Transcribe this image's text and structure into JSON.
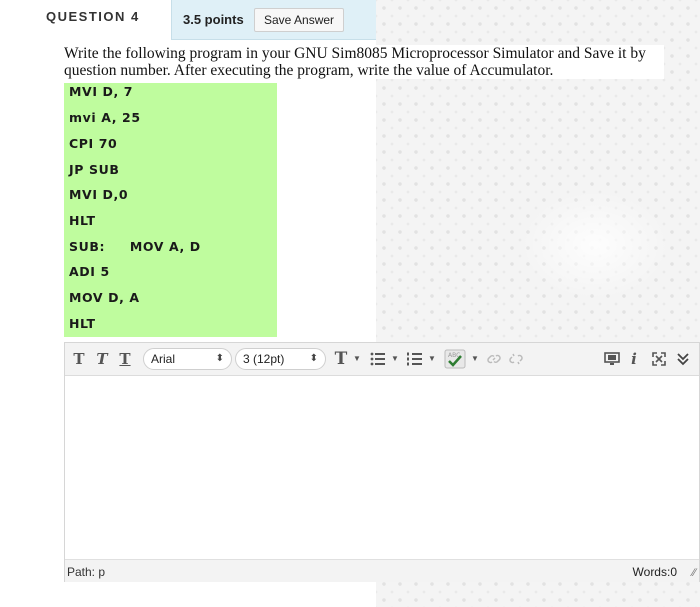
{
  "question": {
    "title": "QUESTION 4",
    "points": "3.5 points",
    "save_label": "Save Answer",
    "text": "Write the following program in your GNU Sim8085 Microprocessor Simulator and Save it by question number. After executing the program, write the value of Accumulator."
  },
  "code_lines": [
    "MVI D, 7",
    "mvi A, 25",
    "CPI 70",
    "JP SUB",
    "MVI D,0",
    "HLT",
    "SUB:     MOV A, D",
    "ADI 5",
    "MOV D, A",
    "HLT"
  ],
  "editor": {
    "toolbar": {
      "bold_glyph": "T",
      "italic_glyph": "T",
      "underline_glyph": "T",
      "font_family": "Arial",
      "font_size": "3 (12pt)",
      "text_color_glyph": "T",
      "bullet_list_icon": "bullet-list-icon",
      "numbered_list_icon": "numbered-list-icon",
      "spellcheck_icon": "spellcheck-icon",
      "link_icon": "link-icon",
      "unlink_icon": "unlink-icon",
      "preview_icon": "preview-icon",
      "info_icon": "info-icon",
      "fullscreen_icon": "fullscreen-icon",
      "collapse_icon": "collapse-icon"
    },
    "path_label": "Path: p",
    "word_count": "Words:0"
  },
  "colors": {
    "code_background": "#bffc9e",
    "points_background": "#dff0f7"
  }
}
